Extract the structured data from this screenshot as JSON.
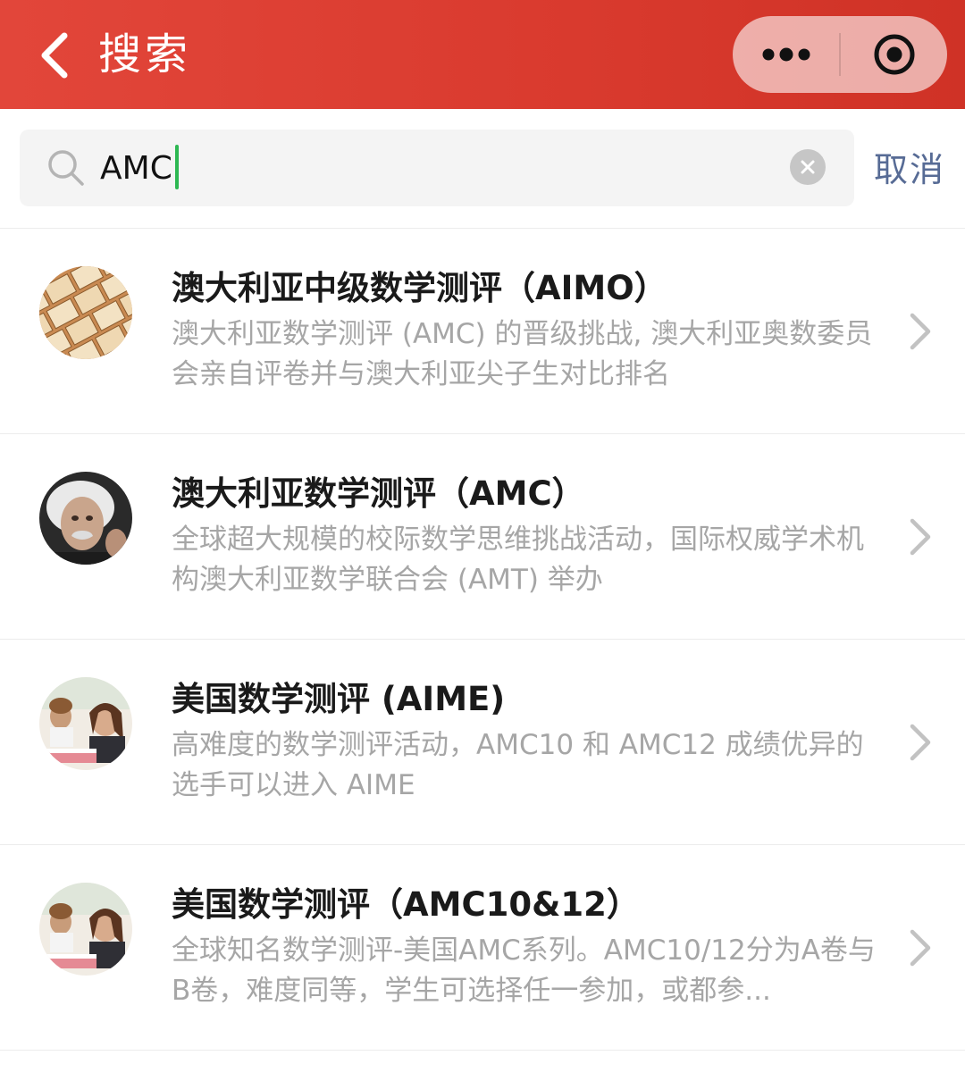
{
  "header": {
    "title": "搜索",
    "back_icon": "chevron-left-icon",
    "more_icon": "more-dots-icon",
    "close_icon": "target-close-icon",
    "background": "#d93a2e"
  },
  "search": {
    "value": "AMC",
    "placeholder": "",
    "cancel_label": "取消",
    "caret_color": "#2db852",
    "link_color": "#576b95"
  },
  "results": [
    {
      "title": "澳大利亚中级数学测评（AIMO）",
      "description": "澳大利亚数学测评 (AMC) 的晋级挑战, 澳大利亚奥数委员会亲自评卷并与澳大利亚尖子生对比排名",
      "avatar": "math-tiles-avatar"
    },
    {
      "title": "澳大利亚数学测评（AMC）",
      "description": "全球超大规模的校际数学思维挑战活动，国际权威学术机构澳大利亚数学联合会 (AMT) 举办",
      "avatar": "scientist-portrait-avatar"
    },
    {
      "title": "美国数学测评 (AIME)",
      "description": "高难度的数学测评活动，AMC10 和 AMC12 成绩优异的选手可以进入 AIME",
      "avatar": "students-classroom-avatar"
    },
    {
      "title": "美国数学测评（AMC10&12）",
      "description": "全球知名数学测评-美国AMC系列。AMC10/12分为A卷与B卷，难度同等，学生可选择任一参加，或都参...",
      "avatar": "students-classroom-avatar"
    }
  ]
}
